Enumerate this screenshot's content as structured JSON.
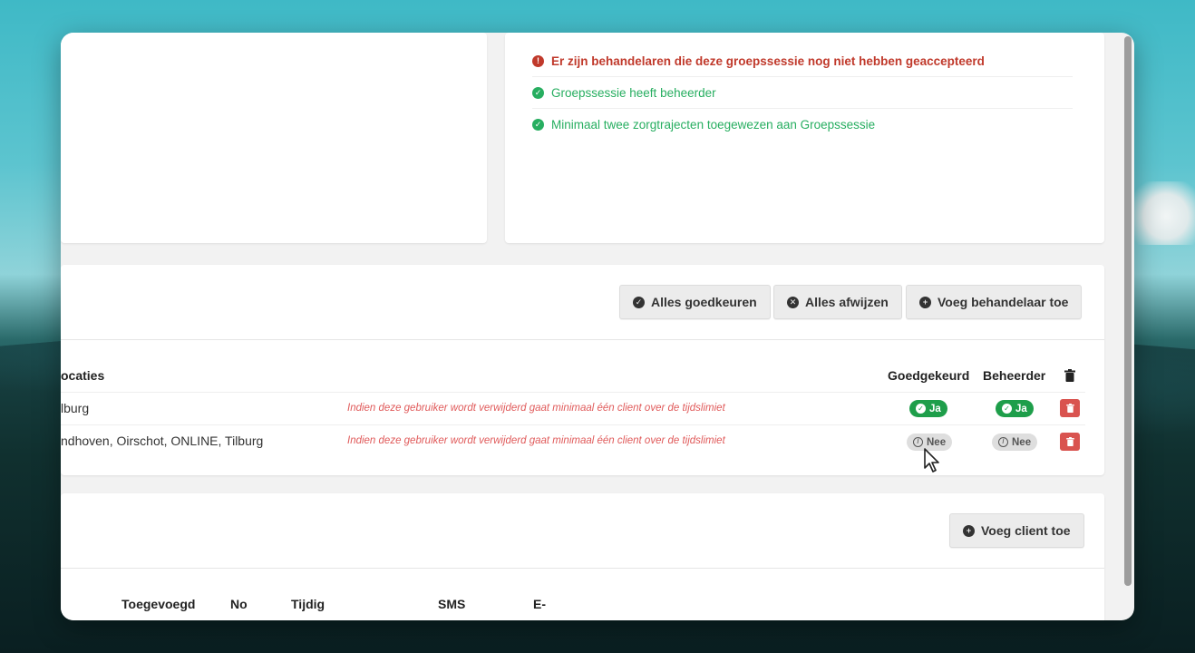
{
  "validation": {
    "items": [
      {
        "status": "error",
        "text": "Er zijn behandelaren die deze groepssessie nog niet hebben geaccepteerd"
      },
      {
        "status": "ok",
        "text": "Groepssessie heeft beheerder"
      },
      {
        "status": "ok",
        "text": "Minimaal twee zorgtrajecten toegewezen aan Groepssessie"
      }
    ]
  },
  "toolbar": {
    "approve_all": "Alles goedkeuren",
    "reject_all": "Alles afwijzen",
    "add_practitioner": "Voeg behandelaar toe"
  },
  "practitioners_table": {
    "headers": {
      "locations": "ocaties",
      "approved": "Goedgekeurd",
      "manager": "Beheerder"
    },
    "rows": [
      {
        "locations": "lburg",
        "warning": "Indien deze gebruiker wordt verwijderd gaat minimaal één client over de tijdslimiet",
        "approved": "Ja",
        "manager": "Ja"
      },
      {
        "locations": "ndhoven, Oirschot, ONLINE, Tilburg",
        "warning": "Indien deze gebruiker wordt verwijderd gaat minimaal één client over de tijdslimiet",
        "approved": "Nee",
        "manager": "Nee"
      }
    ]
  },
  "clients": {
    "add_client": "Voeg client toe",
    "headers": {
      "added": "Toegevoegd",
      "no": "No",
      "timely": "Tijdig",
      "sms": "SMS",
      "email": "E-"
    }
  },
  "colors": {
    "error": "#c0392b",
    "ok": "#27ae60",
    "yes_pill": "#1e9e4a",
    "delete": "#d9534f"
  }
}
